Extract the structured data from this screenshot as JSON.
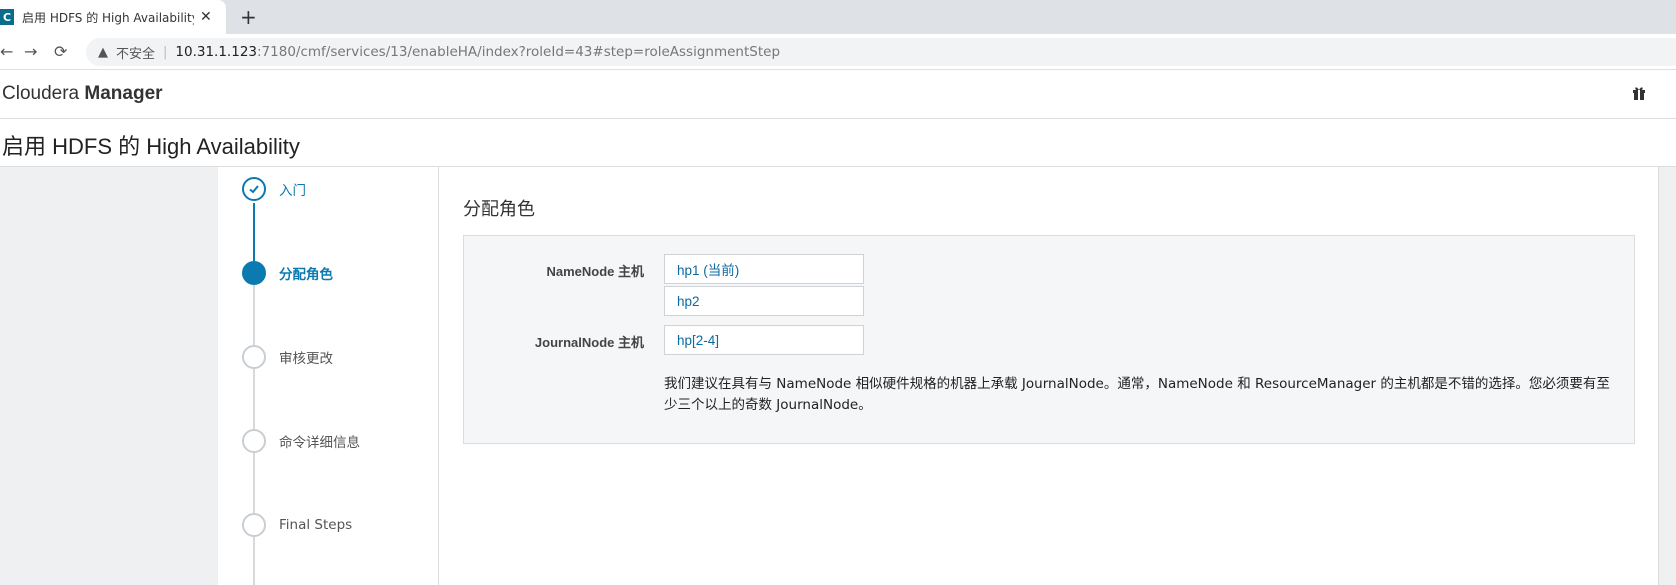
{
  "browser": {
    "tab_title": "启用 HDFS 的 High Availability",
    "favicon_letter": "C",
    "close_glyph": "✕",
    "new_tab_glyph": "+",
    "insecure_label": "不安全",
    "url_host": "10.31.1.123",
    "url_rest": ":7180/cmf/services/13/enableHA/index?roleId=43#step=roleAssignmentStep"
  },
  "header": {
    "brand_light": "Cloudera",
    "brand_bold": "Manager"
  },
  "page": {
    "title": "启用 HDFS 的 High Availability"
  },
  "steps": [
    {
      "label": "入门",
      "state": "done"
    },
    {
      "label": "分配角色",
      "state": "active"
    },
    {
      "label": "审核更改",
      "state": "pending"
    },
    {
      "label": "命令详细信息",
      "state": "pending"
    },
    {
      "label": "Final Steps",
      "state": "pending"
    }
  ],
  "main": {
    "section_title": "分配角色",
    "namenode_label": "NameNode 主机",
    "namenode_hosts": [
      "hp1 (当前)",
      "hp2"
    ],
    "journalnode_label": "JournalNode 主机",
    "journalnode_hosts": "hp[2-4]",
    "hint_line1": "我们建议在具有与 NameNode 相似硬件规格的机器上承载 JournalNode。通常，NameNode 和 ResourceManager 的主机都是不错的选择。您必须要有至",
    "hint_line2": "少三个以上的奇数 JournalNode。"
  },
  "colors": {
    "accent": "#0a7ab0",
    "link": "#0a6aa1",
    "panel_bg": "#f5f6f7",
    "side_gray": "#eef0f2"
  }
}
